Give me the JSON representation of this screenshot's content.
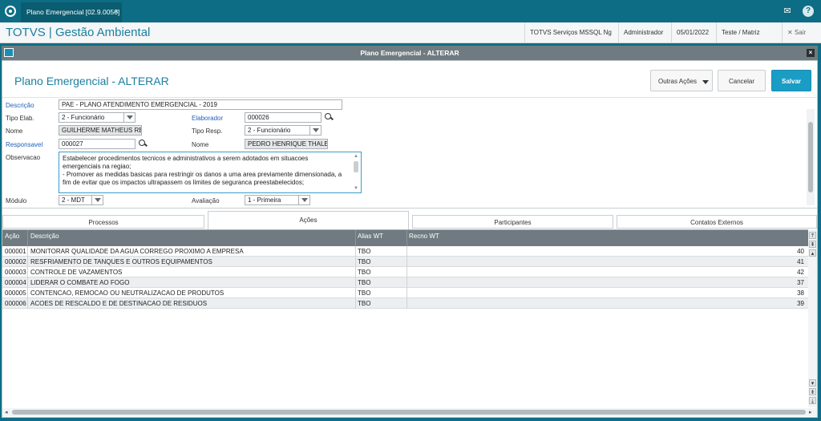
{
  "topbar": {
    "tab_title": "Plano Emergencial [02.9.0056]",
    "tab_close": "×",
    "icons": [
      "app-logo-icon",
      "mail-icon",
      "help-icon"
    ],
    "help_glyph": "?"
  },
  "header": {
    "brand": "TOTVS | Gestão Ambiental",
    "company": "TOTVS Serviços MSSQL Ng",
    "user": "Administrador",
    "date": "05/01/2022",
    "branch": "Teste / Matriz",
    "logout": "✕  Sair"
  },
  "window": {
    "title": "Plano Emergencial - ALTERAR",
    "close": "×"
  },
  "form": {
    "title": "Plano Emergencial - ALTERAR",
    "buttons": {
      "outras": "Outras Ações",
      "cancelar": "Cancelar",
      "salvar": "Salvar"
    },
    "fields": {
      "descricao_label": "Descrição",
      "descricao_value": "PAE - PLANO ATENDIMENTO EMERGENCIAL - 2019",
      "tipo_elab_label": "Tipo Elab.",
      "tipo_elab_value": "2 - Funcionário",
      "elaborador_label": "Elaborador",
      "elaborador_value": "000026",
      "nome1_label": "Nome",
      "nome1_value": "GUILHERME MATHEUS REZE",
      "tipo_resp_label": "Tipo Resp.",
      "tipo_resp_value": "2 - Funcionário",
      "responsavel_label": "Responsavel",
      "responsavel_value": "000027",
      "nome2_label": "Nome",
      "nome2_value": "PEDRO HENRIQUE THALES",
      "observacao_label": "Observacao",
      "observacao_value": "Estabelecer procedimentos tecnicos e administrativos a serem adotados em situacoes emergenciais na regiao;\n- Promover as medidas basicas para restringir os danos a uma area previamente dimensionada, a fim de evitar que os impactos ultrapassem os limites de seguranca preestabelecidos;",
      "modulo_label": "Módulo",
      "modulo_value": "2 - MDT",
      "avaliacao_label": "Avaliação",
      "avaliacao_value": "1 - Primeira"
    }
  },
  "subtabs": [
    "Processos",
    "Ações",
    "Participantes",
    "Contatos Externos"
  ],
  "grid": {
    "columns": [
      "Ação",
      "Descrição",
      "Alias WT",
      "Recno WT"
    ],
    "rows": [
      [
        "000001",
        "MONITORAR QUALIDADE DA AGUA CORREGO PROXIMO A EMPRESA",
        "TBO",
        "40"
      ],
      [
        "000002",
        "RESFRIAMENTO DE TANQUES E OUTROS EQUIPAMENTOS",
        "TBO",
        "41"
      ],
      [
        "000003",
        "CONTROLE DE VAZAMENTOS",
        "TBO",
        "42"
      ],
      [
        "000004",
        "LIDERAR O COMBATE AO FOGO",
        "TBO",
        "37"
      ],
      [
        "000005",
        "CONTENCAO, REMOCAO OU NEUTRALIZACAO DE PRODUTOS",
        "TBO",
        "38"
      ],
      [
        "000006",
        "ACOES DE RESCALDO E DE DESTINACAO DE RESIDUOS",
        "TBO",
        "39"
      ]
    ]
  },
  "colors": {
    "topbar": "#0c6d85",
    "brand": "#1a7fa0",
    "save": "#1a9dc5",
    "grid_header": "#6f7b80",
    "required_label": "#1f5fb8"
  }
}
